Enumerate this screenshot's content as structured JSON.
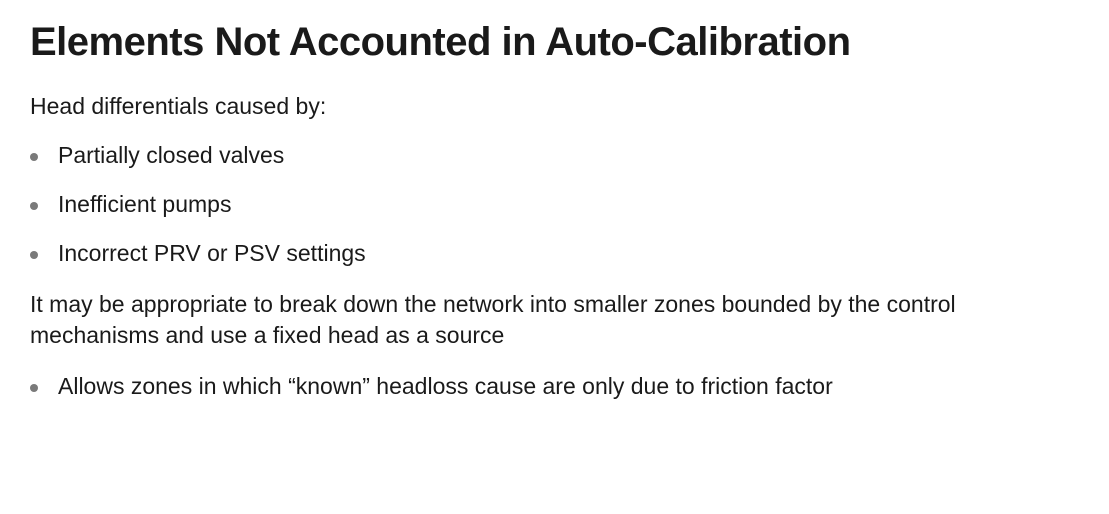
{
  "heading": "Elements Not Accounted in Auto-Calibration",
  "intro": "Head differentials caused by:",
  "list1": [
    "Partially closed valves",
    "Inefficient pumps",
    "Incorrect PRV or PSV settings"
  ],
  "para": "It may be appropriate to break down the network into smaller zones bounded by the control mechanisms and use a fixed head as a source",
  "list2": [
    "Allows zones in which “known” headloss cause are only due to friction factor"
  ]
}
